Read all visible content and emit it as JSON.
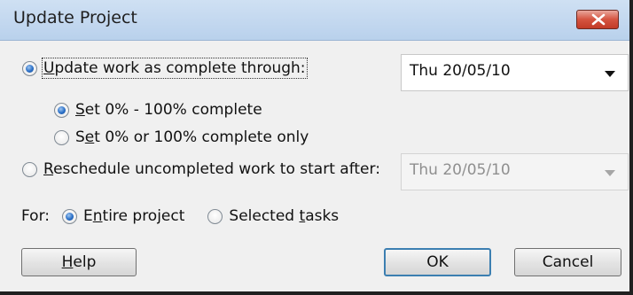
{
  "dialog": {
    "title": "Update Project",
    "close_icon": "close-icon"
  },
  "update_option": {
    "pre": "",
    "accel": "U",
    "post": "pdate work as complete through:",
    "checked": true
  },
  "update_date": {
    "value": "Thu 20/05/10"
  },
  "sub_option_1": {
    "pre": "",
    "accel": "S",
    "post": "et 0% - 100% complete",
    "checked": true
  },
  "sub_option_2": {
    "pre": "S",
    "accel": "e",
    "post": "t 0% or 100% complete only",
    "checked": false
  },
  "reschedule_option": {
    "pre": "",
    "accel": "R",
    "post": "eschedule uncompleted work to start after:",
    "checked": false
  },
  "reschedule_date": {
    "value": "Thu 20/05/10",
    "disabled": true
  },
  "for_row": {
    "label": "For:",
    "entire": {
      "pre": "E",
      "accel": "n",
      "post": "tire project",
      "checked": true
    },
    "selected": {
      "pre": "Selected ",
      "accel": "t",
      "post": "asks",
      "checked": false
    }
  },
  "buttons": {
    "help": {
      "pre": "",
      "accel": "H",
      "post": "elp"
    },
    "ok": "OK",
    "cancel": "Cancel"
  }
}
